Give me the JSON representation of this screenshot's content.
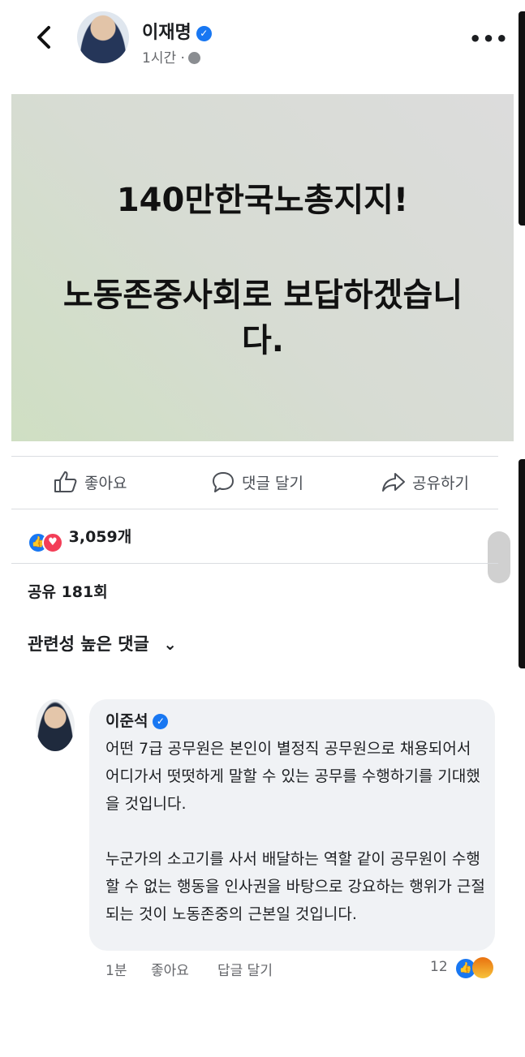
{
  "header": {
    "author": "이재명",
    "time": "1시간 ·",
    "more": "•••"
  },
  "post": {
    "line1": "140만한국노총지지!",
    "line2": "노동존중사회로 보답하겠습니다."
  },
  "actions": {
    "like": "좋아요",
    "comment": "댓글 달기",
    "share": "공유하기"
  },
  "stats": {
    "reactions": "3,059개",
    "shares": "공유 181회"
  },
  "sort": {
    "label": "관련성 높은 댓글",
    "chevron": "⌄"
  },
  "comment": {
    "author": "이준석",
    "paragraph1": "어떤 7급 공무원은 본인이 별정직 공무원으로 채용되어서 어디가서 떳떳하게 말할 수 있는 공무를 수행하기를 기대했을 것입니다.",
    "paragraph2": "누군가의 소고기를 사서 배달하는 역할 같이 공무원이 수행할 수 없는 행동을 인사권을 바탕으로 강요하는 행위가 근절되는 것이 노동존중의 근본일 것입니다.",
    "time": "1분",
    "like": "좋아요",
    "reply": "답글 달기",
    "reaction_count": "12"
  },
  "colors": {
    "brand": "#1877f2",
    "love": "#f33e58",
    "bubble": "#f0f2f5"
  },
  "icons": [
    "back-icon",
    "verified-icon",
    "globe-icon",
    "more-icon",
    "thumbs-up-icon",
    "comment-icon",
    "share-icon",
    "like-reaction-icon",
    "love-reaction-icon",
    "angry-reaction-icon",
    "chevron-down-icon"
  ]
}
